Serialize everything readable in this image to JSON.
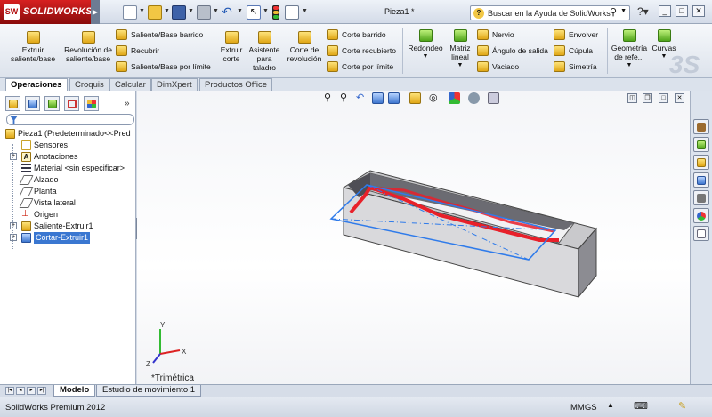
{
  "app": {
    "name": "SOLIDWORKS",
    "logo_initials": "SW",
    "document_title": "Pieza1 *"
  },
  "search": {
    "placeholder": "Buscar en la Ayuda de SolidWorks"
  },
  "ribbon": {
    "large_buttons": [
      {
        "label": "Extruir saliente/base",
        "icon": "extrude-boss-icon"
      },
      {
        "label": "Revolución de saliente/base",
        "icon": "revolve-boss-icon"
      },
      {
        "label": "Extruir corte",
        "icon": "extrude-cut-icon"
      },
      {
        "label": "Asistente para taladro",
        "icon": "hole-wizard-icon"
      },
      {
        "label": "Corte de revolución",
        "icon": "revolve-cut-icon"
      },
      {
        "label": "Redondeo",
        "icon": "fillet-icon"
      },
      {
        "label": "Matriz lineal",
        "icon": "linear-pattern-icon"
      },
      {
        "label": "Geometría de refe...",
        "icon": "reference-geometry-icon"
      },
      {
        "label": "Curvas",
        "icon": "curves-icon"
      }
    ],
    "small_buttons": [
      {
        "label": "Saliente/Base barrido",
        "icon": "swept-boss-icon"
      },
      {
        "label": "Recubrir",
        "icon": "loft-icon"
      },
      {
        "label": "Saliente/Base por límite",
        "icon": "boundary-boss-icon"
      },
      {
        "label": "Corte barrido",
        "icon": "swept-cut-icon"
      },
      {
        "label": "Corte recubierto",
        "icon": "lofted-cut-icon"
      },
      {
        "label": "Corte por límite",
        "icon": "boundary-cut-icon"
      },
      {
        "label": "Nervio",
        "icon": "rib-icon"
      },
      {
        "label": "Ángulo de salida",
        "icon": "draft-icon"
      },
      {
        "label": "Vaciado",
        "icon": "shell-icon"
      },
      {
        "label": "Envolver",
        "icon": "wrap-icon"
      },
      {
        "label": "Cúpula",
        "icon": "dome-icon"
      },
      {
        "label": "Simetría",
        "icon": "mirror-icon"
      }
    ]
  },
  "tabs": [
    "Operaciones",
    "Croquis",
    "Calcular",
    "DimXpert",
    "Productos Office"
  ],
  "tree": {
    "root": "Pieza1  (Predeterminado<<Pred",
    "items": [
      {
        "label": "Sensores",
        "icon": "sensors-icon"
      },
      {
        "label": "Anotaciones",
        "icon": "annotations-icon"
      },
      {
        "label": "Material <sin especificar>",
        "icon": "material-icon"
      },
      {
        "label": "Alzado",
        "icon": "plane-icon"
      },
      {
        "label": "Planta",
        "icon": "plane-icon"
      },
      {
        "label": "Vista lateral",
        "icon": "plane-icon"
      },
      {
        "label": "Origen",
        "icon": "origin-icon"
      },
      {
        "label": "Saliente-Extruir1",
        "icon": "extrude-feature-icon"
      },
      {
        "label": "Cortar-Extruir1",
        "icon": "cut-feature-icon"
      }
    ]
  },
  "view": {
    "orientation": "*Trimétrica",
    "triad": {
      "x": "X",
      "y": "Y",
      "z": "Z"
    }
  },
  "bottom_tabs": [
    "Modelo",
    "Estudio de movimiento 1"
  ],
  "status": {
    "product": "SolidWorks Premium 2012",
    "units": "MMGS"
  },
  "colors": {
    "accent": "#3a77d1",
    "brand": "#c0161a",
    "part_face": "#c9c9cc",
    "sketch_red": "#e8202a",
    "selection_blue": "#2f7bea"
  }
}
